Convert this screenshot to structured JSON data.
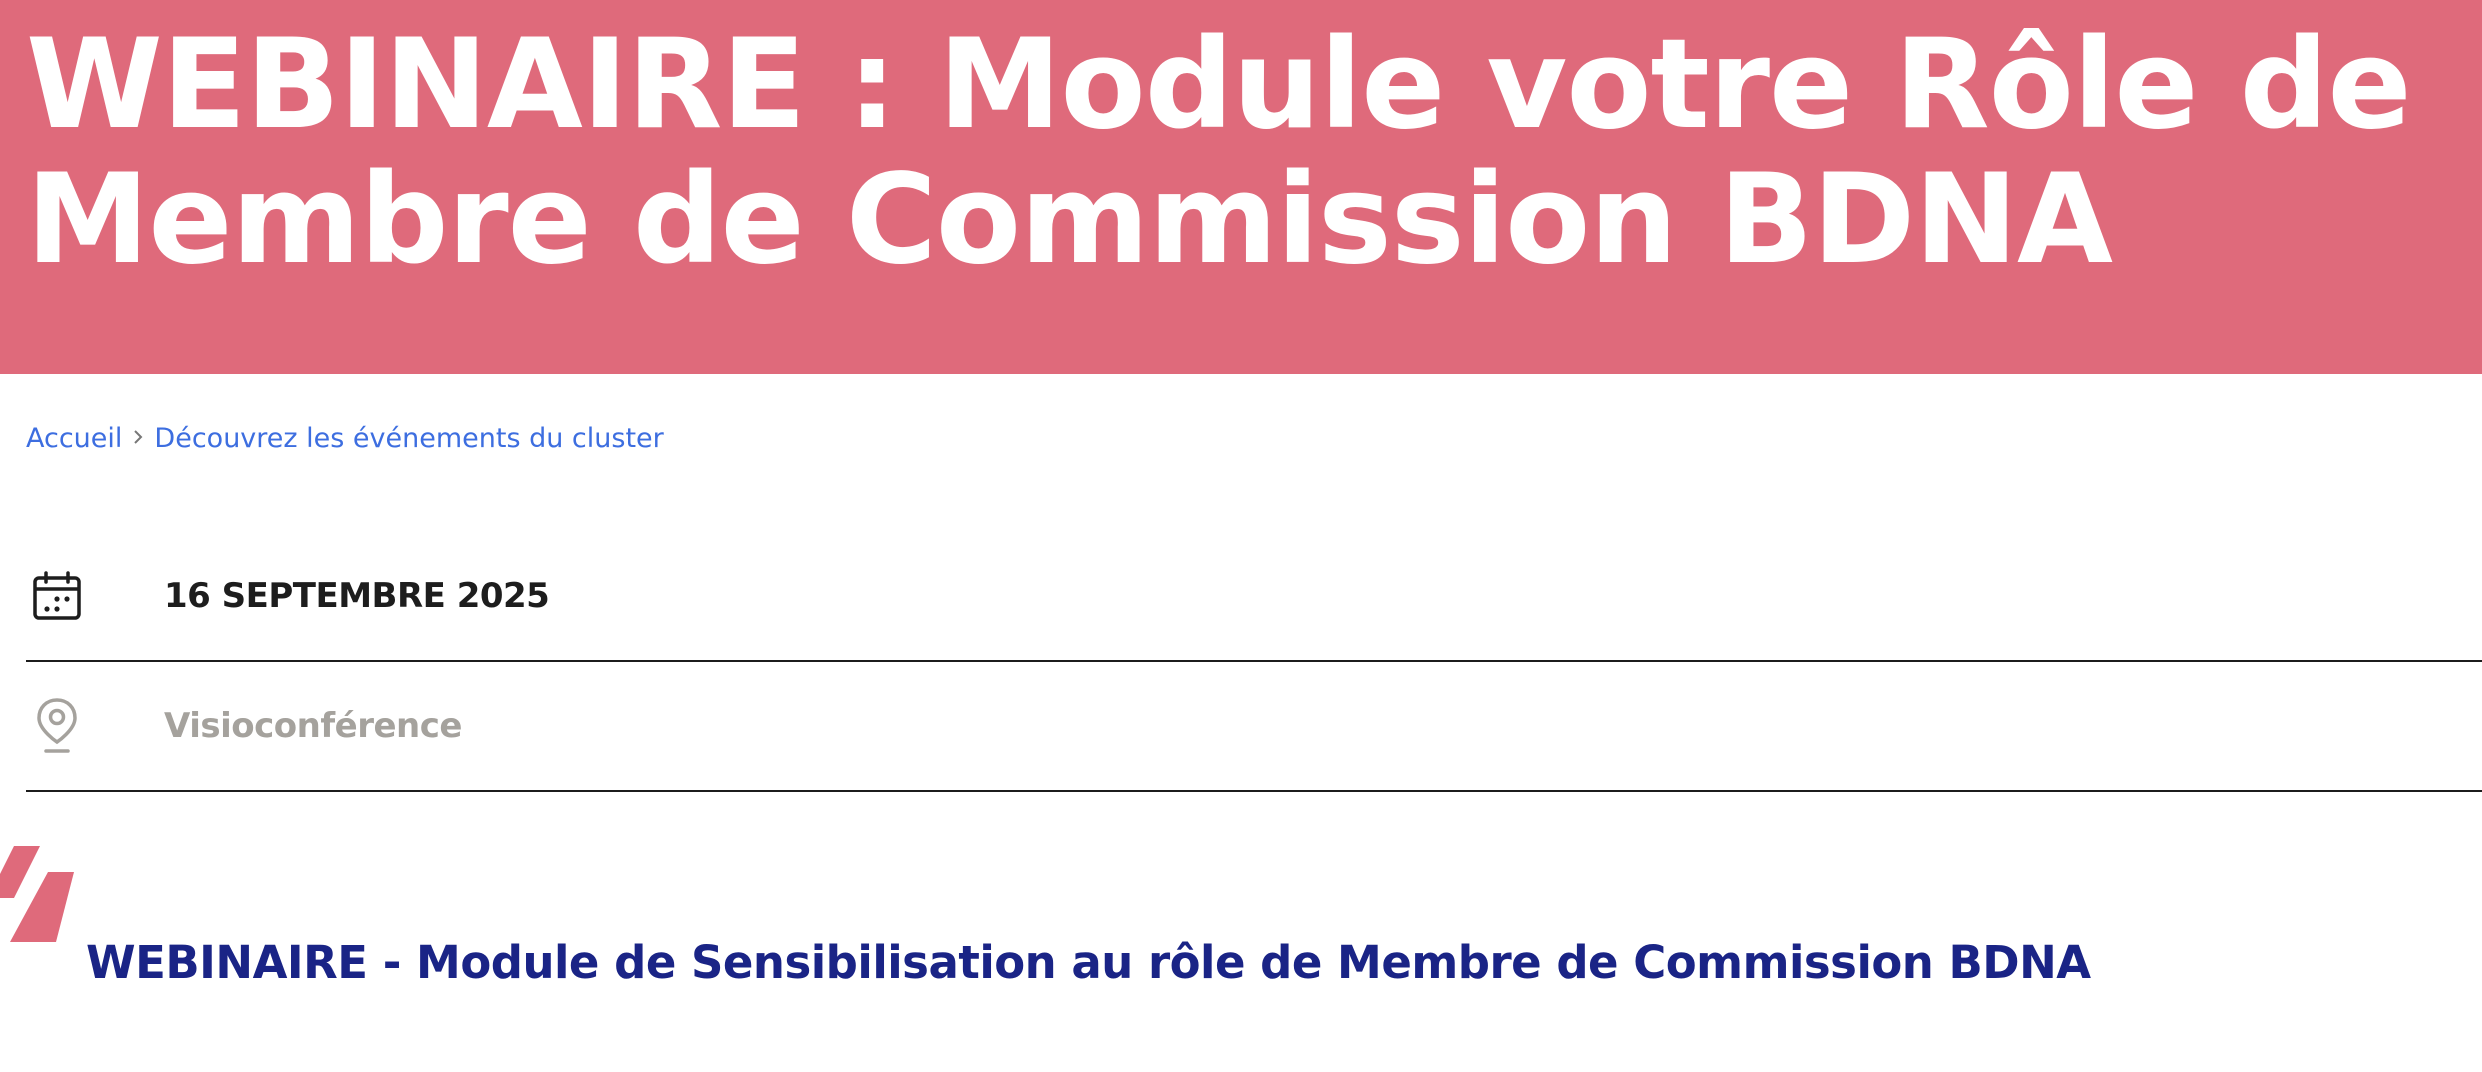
{
  "hero": {
    "title": "WEBINAIRE : Module votre Rôle de Membre de Commission BDNA",
    "background_color": "#df6a7b"
  },
  "breadcrumb": {
    "items": [
      {
        "label": "Accueil"
      },
      {
        "label": "Découvrez les événements du cluster"
      }
    ],
    "separator_icon": "chevron-right-icon",
    "link_color": "#3d6ee0"
  },
  "event": {
    "date": "16 SEPTEMBRE 2025",
    "date_icon": "calendar-icon",
    "location": "Visioconférence",
    "location_icon": "map-pin-icon",
    "subtitle": "WEBINAIRE - Module de Sensibilisation au rôle de Membre de Commission BDNA",
    "subtitle_color": "#1a2486",
    "decoration_icon": "double-slash-icon"
  }
}
